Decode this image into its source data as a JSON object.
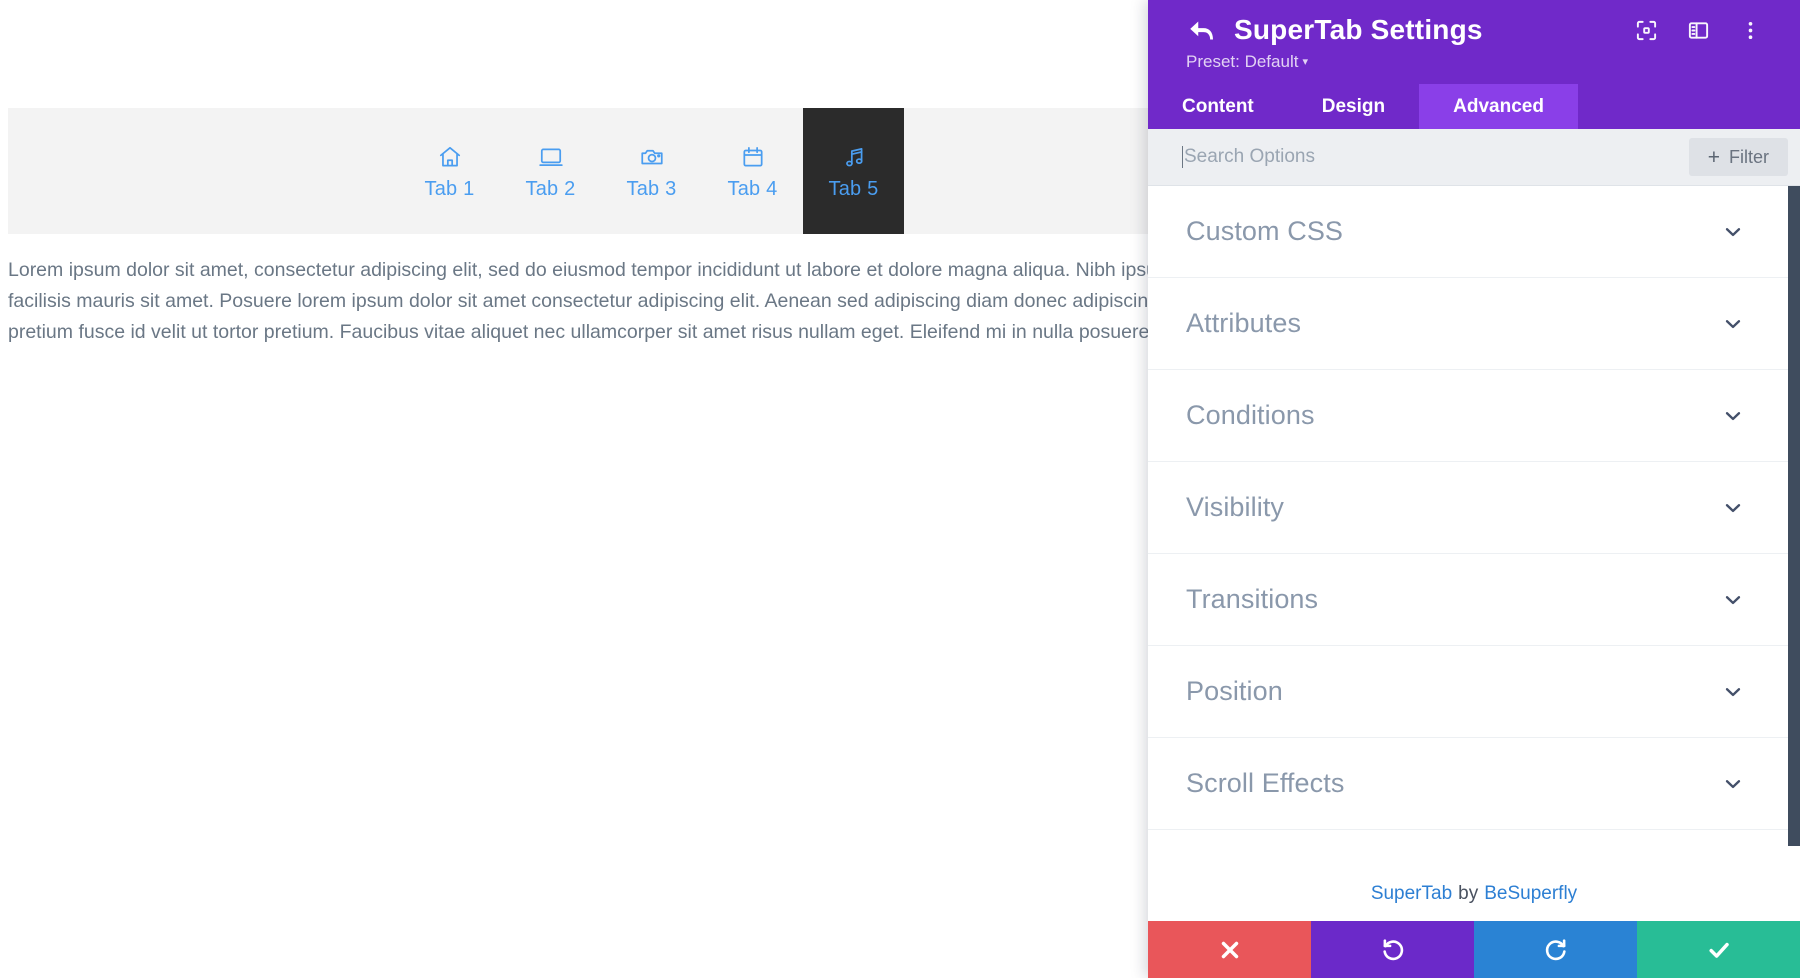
{
  "page": {
    "tabs": [
      {
        "label": "Tab 1",
        "icon": "home-icon",
        "active": false
      },
      {
        "label": "Tab 2",
        "icon": "monitor-icon",
        "active": false
      },
      {
        "label": "Tab 3",
        "icon": "camera-icon",
        "active": false
      },
      {
        "label": "Tab 4",
        "icon": "calendar-icon",
        "active": false
      },
      {
        "label": "Tab 5",
        "icon": "music-note-icon",
        "active": true
      }
    ],
    "active_tab_bg": "#2b2b2b",
    "tab_text_color": "#4a9df0",
    "body_lines": [
      "Lorem ipsum dolor sit amet, consectetur adipiscing elit, sed do eiusmod tempor incididunt ut labore et dolore magna aliqua. Nibh ipsum consequat nisl vel",
      "facilisis mauris sit amet. Posuere lorem ipsum dolor sit amet consectetur adipiscing elit. Aenean sed adipiscing diam donec adipiscing tristique risus nec",
      "pretium fusce id velit ut tortor pretium. Faucibus vitae aliquet nec ullamcorper sit amet risus nullam eget. Eleifend mi in nulla posuere sollicitudin aliquam"
    ]
  },
  "panel": {
    "title": "SuperTab Settings",
    "back_icon": "back-arrow-icon",
    "header_icons": [
      {
        "name": "focus-frame-icon"
      },
      {
        "name": "panel-layout-icon"
      },
      {
        "name": "more-vertical-icon"
      }
    ],
    "preset_label": "Preset: Default",
    "preset_caret": "▾",
    "header_bg": "#7029c9",
    "active_tab_bg": "#8a3fe8",
    "tabs": [
      {
        "label": "Content",
        "active": false
      },
      {
        "label": "Design",
        "active": false
      },
      {
        "label": "Advanced",
        "active": true
      }
    ],
    "search": {
      "placeholder": "Search Options",
      "value": ""
    },
    "filter_button": {
      "plus": "+",
      "label": "Filter"
    },
    "sections": [
      {
        "label": "Custom CSS",
        "chevron": "chevron-down-icon"
      },
      {
        "label": "Attributes",
        "chevron": "chevron-down-icon"
      },
      {
        "label": "Conditions",
        "chevron": "chevron-down-icon"
      },
      {
        "label": "Visibility",
        "chevron": "chevron-down-icon"
      },
      {
        "label": "Transitions",
        "chevron": "chevron-down-icon"
      },
      {
        "label": "Position",
        "chevron": "chevron-down-icon"
      },
      {
        "label": "Scroll Effects",
        "chevron": "chevron-down-icon"
      }
    ],
    "credit": {
      "product": "SuperTab",
      "by": "by",
      "vendor": "BeSuperfly",
      "link_color": "#2d7fd3"
    },
    "footer_buttons": [
      {
        "name": "cancel-button",
        "icon": "close-icon",
        "color": "#e9565a"
      },
      {
        "name": "undo-button",
        "icon": "undo-icon",
        "color": "#6b29c9"
      },
      {
        "name": "redo-button",
        "icon": "redo-icon",
        "color": "#2a83d4"
      },
      {
        "name": "save-button",
        "icon": "check-icon",
        "color": "#28bd96"
      }
    ]
  }
}
